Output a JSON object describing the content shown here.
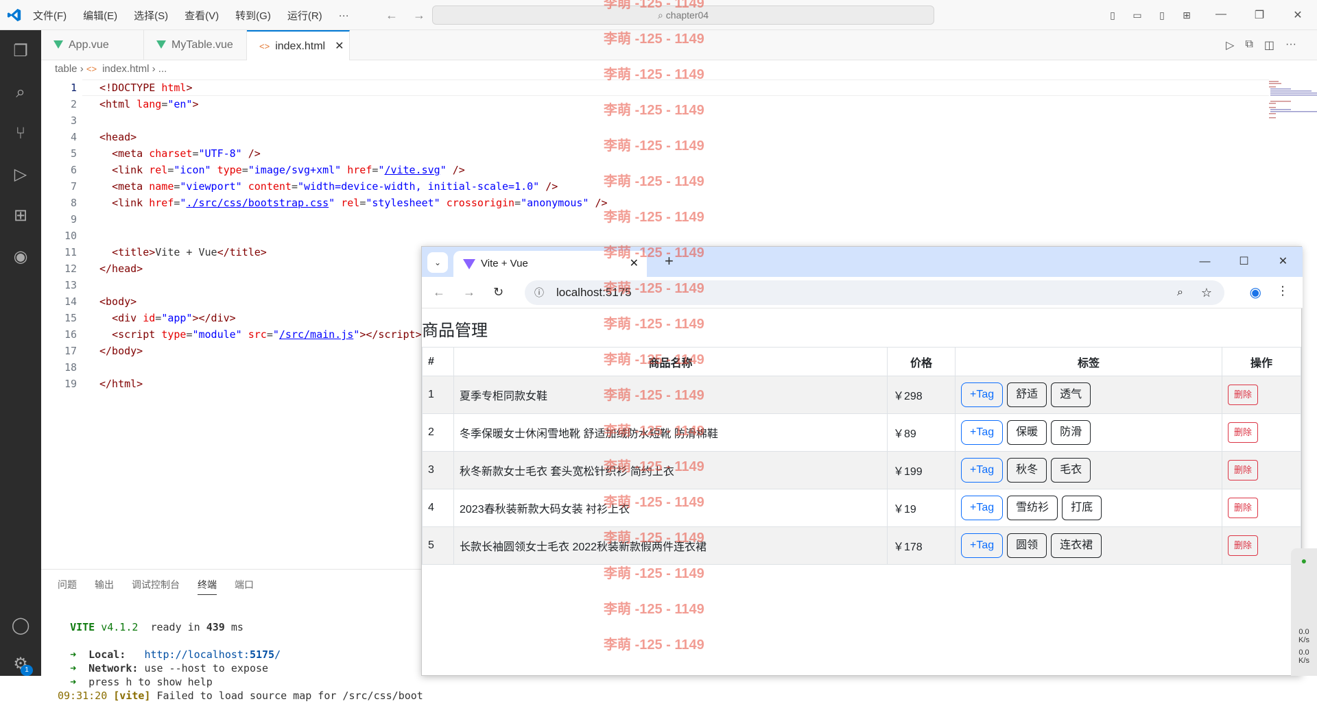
{
  "menu": [
    "文件(F)",
    "编辑(E)",
    "选择(S)",
    "查看(V)",
    "转到(G)",
    "运行(R)",
    "···"
  ],
  "command_center": "chapter04",
  "tabs": [
    {
      "label": "App.vue",
      "type": "vue"
    },
    {
      "label": "MyTable.vue",
      "type": "vue"
    },
    {
      "label": "index.html",
      "type": "html",
      "active": true
    }
  ],
  "breadcrumb": {
    "folder": "table",
    "file": "index.html",
    "more": "..."
  },
  "code_lines": [
    "&lt;!DOCTYPE html&gt;"
  ],
  "panel": {
    "tabs": [
      "问题",
      "输出",
      "调试控制台",
      "终端",
      "端口"
    ],
    "active_tab": "终端",
    "terminal": {
      "vite_name": "VITE",
      "vite_version": "v4.1.2",
      "ready_text": "ready in",
      "ready_ms": "439",
      "ready_unit": "ms",
      "local_label": "Local:",
      "local_url_prefix": "http://localhost:",
      "local_port": "5175",
      "local_url_suffix": "/",
      "network_label": "Network:",
      "network_text": "use --host to expose",
      "help_text": "press h to show help",
      "time": "09:31:20",
      "tag": "[vite]",
      "error_text": "Failed to load source map for /src/css/boot"
    }
  },
  "browser": {
    "tab_title": "Vite + Vue",
    "url": "localhost:5175",
    "page_title": "商品管理",
    "columns": [
      "#",
      "商品名称",
      "价格",
      "标签",
      "操作"
    ],
    "add_tag_label": "+Tag",
    "delete_label": "删除",
    "rows": [
      {
        "id": "1",
        "name": "夏季专柜同款女鞋",
        "price": "￥298",
        "tags": [
          "舒适",
          "透气"
        ]
      },
      {
        "id": "2",
        "name": "冬季保暖女士休闲雪地靴 舒适加绒防水短靴 防滑棉鞋",
        "price": "￥89",
        "tags": [
          "保暖",
          "防滑"
        ]
      },
      {
        "id": "3",
        "name": "秋冬新款女士毛衣 套头宽松针织衫 简约上衣",
        "price": "￥199",
        "tags": [
          "秋冬",
          "毛衣"
        ]
      },
      {
        "id": "4",
        "name": "2023春秋装新款大码女装 衬衫上衣",
        "price": "￥19",
        "tags": [
          "雪纺衫",
          "打底"
        ]
      },
      {
        "id": "5",
        "name": "长款长袖圆领女士毛衣 2022秋装新款假两件连衣裙",
        "price": "￥178",
        "tags": [
          "圆领",
          "连衣裙"
        ]
      }
    ]
  },
  "watermark": "李萌 -125 - 1149",
  "gadget": {
    "speed1": "0.0",
    "unit1": "K/s",
    "speed2": "0.0",
    "unit2": "K/s"
  },
  "activity_badge": "1",
  "colors": {
    "accent": "#0078d4",
    "vue": "#42b883",
    "danger": "#dc3545",
    "primary": "#0d6efd",
    "watermark": "#e74c3c"
  }
}
